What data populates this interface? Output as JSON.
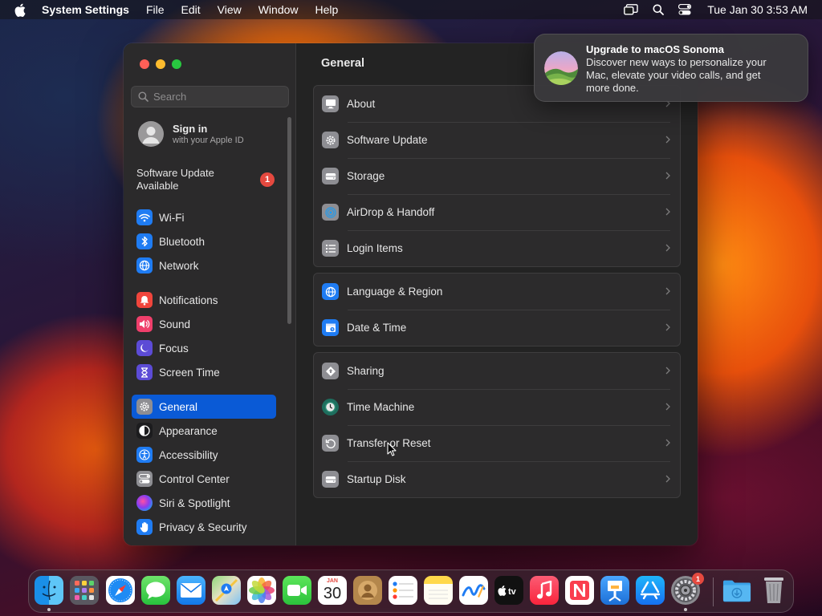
{
  "menubar": {
    "app_name": "System Settings",
    "items": [
      "File",
      "Edit",
      "View",
      "Window"
    ],
    "help": "Help",
    "clock": "Tue Jan 30  3:53 AM"
  },
  "window": {
    "search_placeholder": "Search",
    "account": {
      "title": "Sign in",
      "subtitle": "with your Apple ID"
    },
    "update": {
      "label": "Software Update Available",
      "count": "1"
    },
    "sidebar": {
      "group1": [
        "Wi‑Fi",
        "Bluetooth",
        "Network"
      ],
      "group2": [
        "Notifications",
        "Sound",
        "Focus",
        "Screen Time"
      ],
      "group3": [
        "General",
        "Appearance",
        "Accessibility",
        "Control Center",
        "Siri & Spotlight",
        "Privacy & Security"
      ],
      "selected": "General"
    },
    "main": {
      "title": "General",
      "group1": [
        "About",
        "Software Update",
        "Storage",
        "AirDrop & Handoff",
        "Login Items"
      ],
      "group2": [
        "Language & Region",
        "Date & Time"
      ],
      "group3": [
        "Sharing",
        "Time Machine",
        "Transfer or Reset",
        "Startup Disk"
      ]
    }
  },
  "notification": {
    "title": "Upgrade to macOS Sonoma",
    "body": "Discover new ways to personalize your Mac, elevate your video calls, and get more done."
  },
  "dock": {
    "calendar_month": "JAN",
    "calendar_day": "30",
    "settings_badge": "1",
    "apps": [
      "Finder",
      "Launchpad",
      "Safari",
      "Messages",
      "Mail",
      "Maps",
      "Photos",
      "FaceTime",
      "Calendar",
      "Contacts",
      "Reminders",
      "Notes",
      "Freeform",
      "TV",
      "Music",
      "News",
      "Keynote",
      "App Store",
      "System Settings",
      "Downloads",
      "Trash"
    ]
  },
  "colors": {
    "accent": "#0a5ad6",
    "badge": "#e5493f",
    "window_bg": "#232323",
    "sidebar_bg": "#2b2a2b"
  }
}
